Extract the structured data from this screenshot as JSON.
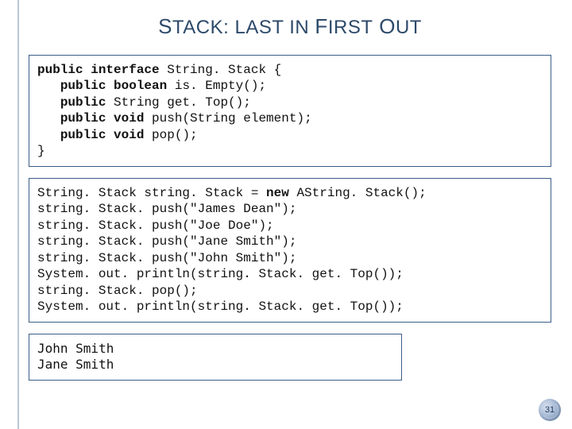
{
  "title": {
    "parts": [
      "S",
      "TACK",
      ": L",
      "AST",
      " IN ",
      "F",
      "IRST",
      " O",
      "UT"
    ]
  },
  "code_interface": {
    "l1": {
      "a": "public interface ",
      "b": "String. Stack {"
    },
    "l2": {
      "a": "public boolean ",
      "b": "is. Empty();"
    },
    "l3": {
      "a": "public ",
      "b": "String get. Top();"
    },
    "l4": {
      "a": "public void ",
      "b": "push(String element);"
    },
    "l5": {
      "a": "public void ",
      "b": "pop();"
    },
    "l6": "}"
  },
  "code_usage": {
    "l1": {
      "a": "String. Stack string. Stack = ",
      "b": "new ",
      "c": "AString. Stack();"
    },
    "l2": "string. Stack. push(\"James Dean\");",
    "l3": "string. Stack. push(\"Joe Doe\");",
    "l4": "string. Stack. push(\"Jane Smith\");",
    "l5": "string. Stack. push(\"John Smith\");",
    "l6": "System. out. println(string. Stack. get. Top());",
    "l7": "string. Stack. pop();",
    "l8": "System. out. println(string. Stack. get. Top());"
  },
  "output": {
    "l1": "John Smith",
    "l2": "Jane Smith"
  },
  "page_number": "31"
}
